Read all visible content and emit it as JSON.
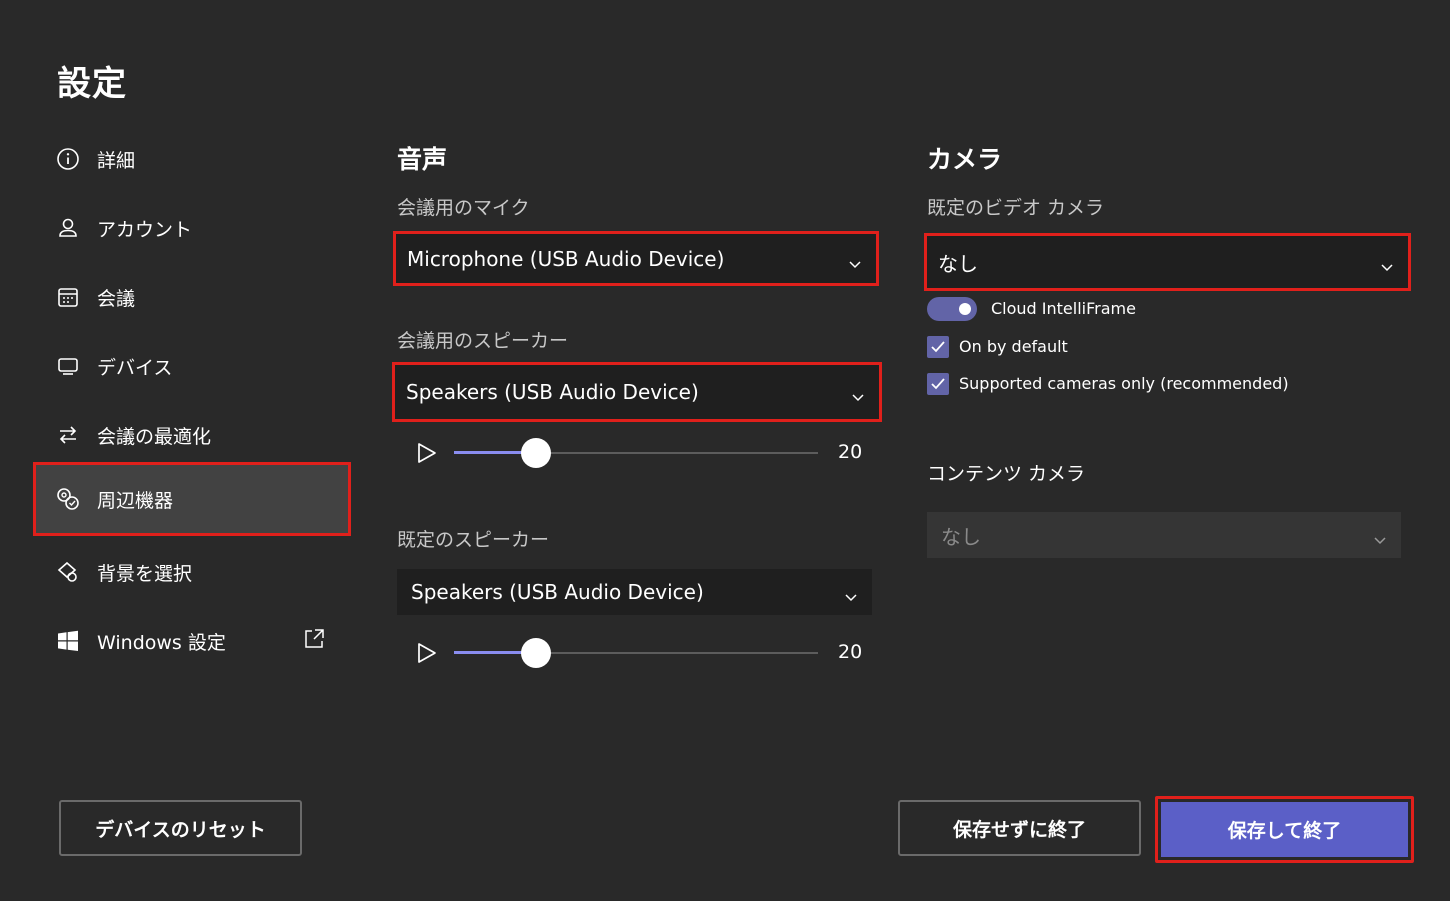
{
  "page": {
    "title": "設定"
  },
  "sidebar": {
    "items": [
      {
        "label": "詳細",
        "icon": "info-icon"
      },
      {
        "label": "アカウント",
        "icon": "person-icon"
      },
      {
        "label": "会議",
        "icon": "calendar-icon"
      },
      {
        "label": "デバイス",
        "icon": "monitor-icon"
      },
      {
        "label": "会議の最適化",
        "icon": "swap-arrows-icon"
      },
      {
        "label": "周辺機器",
        "icon": "peripherals-icon",
        "active": true
      },
      {
        "label": "背景を選択",
        "icon": "shapes-icon"
      },
      {
        "label": "Windows 設定",
        "icon": "windows-logo-icon",
        "external": true
      }
    ]
  },
  "audio": {
    "title": "音声",
    "mic_label": "会議用のマイク",
    "mic_value": "Microphone (USB Audio Device)",
    "meeting_speaker_label": "会議用のスピーカー",
    "meeting_speaker_value": "Speakers (USB Audio Device)",
    "meeting_speaker_volume": "20",
    "default_speaker_label": "既定のスピーカー",
    "default_speaker_value": "Speakers (USB Audio Device)",
    "default_speaker_volume": "20"
  },
  "camera": {
    "title": "カメラ",
    "default_video_label": "既定のビデオ カメラ",
    "default_video_value": "なし",
    "intelliframe_label": "Cloud IntelliFrame",
    "on_by_default_label": "On by default",
    "supported_only_label": "Supported cameras only (recommended)",
    "content_camera_label": "コンテンツ カメラ",
    "content_camera_value": "なし"
  },
  "footer": {
    "reset_label": "デバイスのリセット",
    "exit_without_save_label": "保存せずに終了",
    "save_and_exit_label": "保存して終了"
  },
  "colors": {
    "background": "#292929",
    "accent": "#5b5fc7",
    "highlight": "#e0201b"
  }
}
